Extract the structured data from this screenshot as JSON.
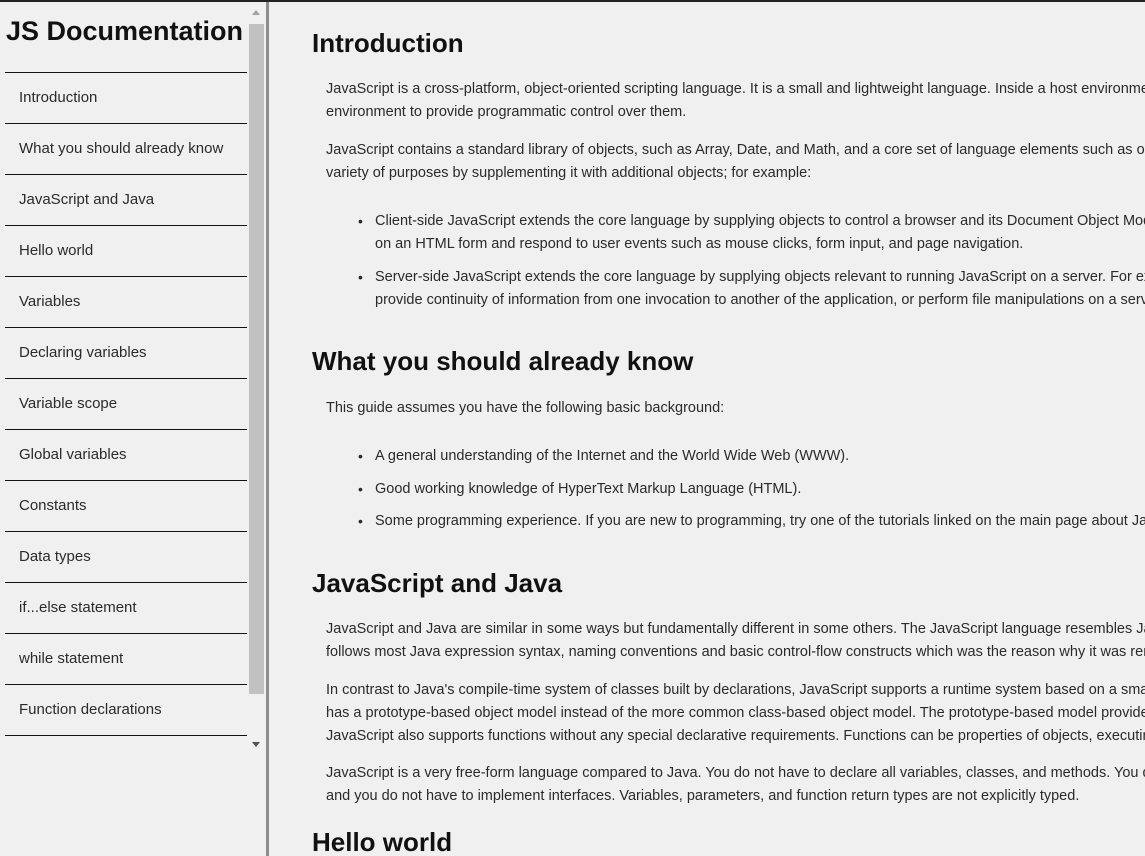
{
  "nav": {
    "header": "JS Documentation",
    "items": [
      {
        "label": "Introduction"
      },
      {
        "label": "What you should already know"
      },
      {
        "label": "JavaScript and Java"
      },
      {
        "label": "Hello world"
      },
      {
        "label": "Variables"
      },
      {
        "label": "Declaring variables"
      },
      {
        "label": "Variable scope"
      },
      {
        "label": "Global variables"
      },
      {
        "label": "Constants"
      },
      {
        "label": "Data types"
      },
      {
        "label": "if...else statement"
      },
      {
        "label": "while statement"
      },
      {
        "label": "Function declarations"
      }
    ]
  },
  "main": {
    "introduction": {
      "title": "Introduction",
      "p1_l1": "JavaScript is a cross-platform, object-oriented scripting language. It is a small and lightweight language. Inside a host environment (for example, a web browser), JavaScript can be connected to the objects of its",
      "p1_l2": "environment to provide programmatic control over them.",
      "p2_l1": "JavaScript contains a standard library of objects, such as Array, Date, and Math, and a core set of language elements such as operators, control structures, and statements. Core JavaScript can be extended for a",
      "p2_l2": "variety of purposes by supplementing it with additional objects; for example:",
      "b1_l1": "Client-side JavaScript extends the core language by supplying objects to control a browser and its Document Object Model (DOM). For example, client-side extensions allow an application to place elements",
      "b1_l2": "on an HTML form and respond to user events such as mouse clicks, form input, and page navigation.",
      "b2_l1": "Server-side JavaScript extends the core language by supplying objects relevant to running JavaScript on a server. For example, server-side extensions allow an application to communicate with a database,",
      "b2_l2": "provide continuity of information from one invocation to another of the application, or perform file manipulations on a server."
    },
    "know": {
      "title": "What you should already know",
      "p1": "This guide assumes you have the following basic background:",
      "b1": "A general understanding of the Internet and the World Wide Web (WWW).",
      "b2": "Good working knowledge of HyperText Markup Language (HTML).",
      "b3": "Some programming experience. If you are new to programming, try one of the tutorials linked on the main page about JavaScript."
    },
    "java": {
      "title": "JavaScript and Java",
      "p1_l1": "JavaScript and Java are similar in some ways but fundamentally different in some others. The JavaScript language resembles Java but does not have Java's static typing and strong type checking. JavaScript",
      "p1_l2": "follows most Java expression syntax, naming conventions and basic control-flow constructs which was the reason why it was renamed from LiveScript to JavaScript.",
      "p2_l1": "In contrast to Java's compile-time system of classes built by declarations, JavaScript supports a runtime system based on a small number of data types representing numeric, Boolean, and string values. JavaScript",
      "p2_l2": "has a prototype-based object model instead of the more common class-based object model. The prototype-based model provides dynamic inheritance; that is, what is inherited can vary for individual objects.",
      "p2_l3": "JavaScript also supports functions without any special declarative requirements. Functions can be properties of objects, executing as loosely typed methods.",
      "p3_l1": "JavaScript is a very free-form language compared to Java. You do not have to declare all variables, classes, and methods. You do not have to be concerned with whether methods are public, private, or protected,",
      "p3_l2": "and you do not have to implement interfaces. Variables, parameters, and function return types are not explicitly typed."
    },
    "hello": {
      "title": "Hello world"
    }
  }
}
